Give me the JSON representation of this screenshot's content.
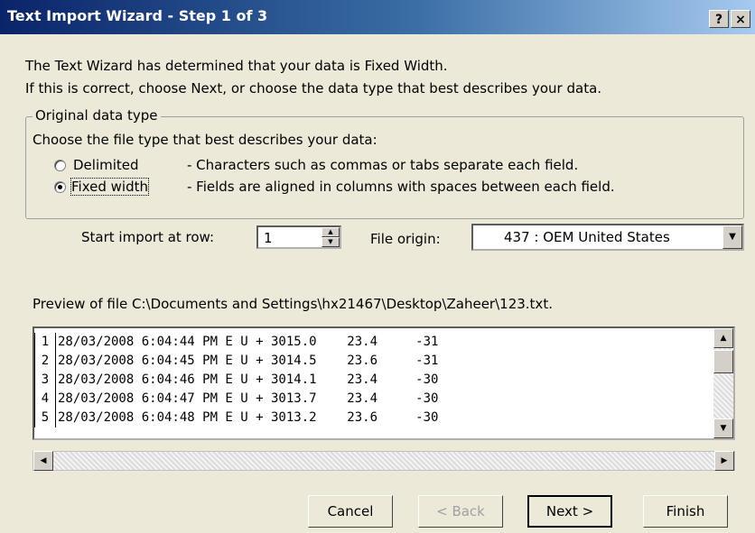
{
  "window": {
    "title": "Text Import Wizard - Step 1 of 3",
    "help_label": "?",
    "close_label": "×"
  },
  "intro": {
    "line1": "The Text Wizard has determined that your data is Fixed Width.",
    "line2": "If this is correct, choose Next, or choose the data type that best describes your data."
  },
  "original_data_type": {
    "group_title": "Original data type",
    "prompt": "Choose the file type that best describes your data:",
    "options": [
      {
        "label": "Delimited",
        "description": "- Characters such as commas or tabs separate each field.",
        "selected": false
      },
      {
        "label": "Fixed width",
        "description": "- Fields are aligned in columns with spaces between each field.",
        "selected": true
      }
    ]
  },
  "start_import": {
    "label": "Start import at row:",
    "value": "1"
  },
  "file_origin": {
    "label": "File origin:",
    "value": "437 : OEM United States"
  },
  "preview": {
    "label": "Preview of file C:\\Documents and Settings\\hx21467\\Desktop\\Zaheer\\123.txt.",
    "rows": [
      {
        "num": "1",
        "text": "28/03/2008 6:04:44 PM E U + 3015.0    23.4     -31"
      },
      {
        "num": "2",
        "text": "28/03/2008 6:04:45 PM E U + 3014.5    23.6     -31"
      },
      {
        "num": "3",
        "text": "28/03/2008 6:04:46 PM E U + 3014.1    23.4     -30"
      },
      {
        "num": "4",
        "text": "28/03/2008 6:04:47 PM E U + 3013.7    23.4     -30"
      },
      {
        "num": "5",
        "text": "28/03/2008 6:04:48 PM E U + 3013.2    23.6     -30"
      }
    ]
  },
  "buttons": {
    "cancel": "Cancel",
    "back": "< Back",
    "next": "Next >",
    "finish": "Finish"
  },
  "colors": {
    "titlebar_start": "#0a246a",
    "titlebar_end": "#a6caf0",
    "dialog_bg": "#ece9d8"
  }
}
